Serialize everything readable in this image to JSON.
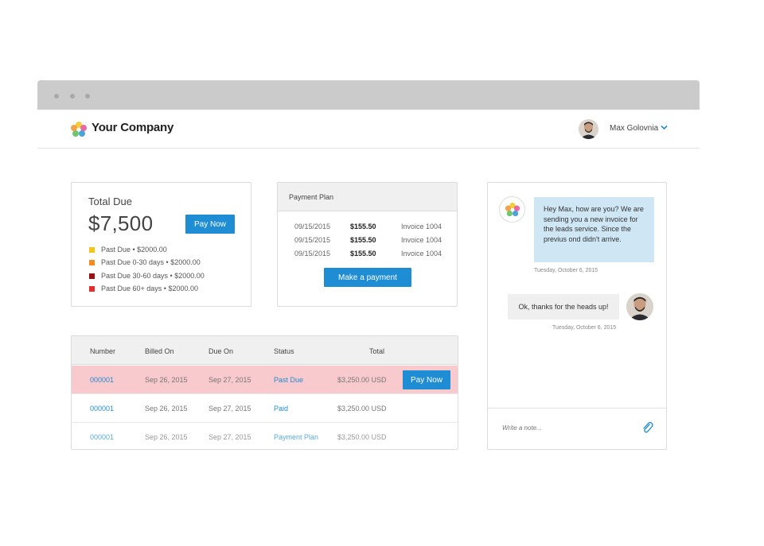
{
  "header": {
    "company_name": "Your Company",
    "user_name": "Max Golovnia"
  },
  "total_due": {
    "title": "Total Due",
    "amount": "$7,500",
    "pay_button": "Pay Now",
    "legend": [
      {
        "label": "Past Due • $2000.00",
        "color": "#f5c518"
      },
      {
        "label": "Past Due 0-30 days • $2000.00",
        "color": "#f28c1e"
      },
      {
        "label": "Past Due 30-60 days • $2000.00",
        "color": "#9b1010"
      },
      {
        "label": "Past Due 60+ days • $2000.00",
        "color": "#e52d2d"
      }
    ]
  },
  "payment_plan": {
    "title": "Payment Plan",
    "rows": [
      {
        "date": "09/15/2015",
        "amount": "$155.50",
        "invoice": "Invoice 1004"
      },
      {
        "date": "09/15/2015",
        "amount": "$155.50",
        "invoice": "Invoice 1004"
      },
      {
        "date": "09/15/2015",
        "amount": "$155.50",
        "invoice": "Invoice 1004"
      }
    ],
    "button": "Make a payment"
  },
  "invoices": {
    "columns": {
      "number": "Number",
      "billed_on": "Billed On",
      "due_on": "Due On",
      "status": "Status",
      "total": "Total"
    },
    "rows": [
      {
        "number": "000001",
        "billed_on": "Sep 26, 2015",
        "due_on": "Sep 27, 2015",
        "status": "Past Due",
        "total": "$3,250.00 USD",
        "action": "Pay Now"
      },
      {
        "number": "000001",
        "billed_on": "Sep 26, 2015",
        "due_on": "Sep 27, 2015",
        "status": "Paid",
        "total": "$3,250.00 USD"
      },
      {
        "number": "000001",
        "billed_on": "Sep 26, 2015",
        "due_on": "Sep 27, 2015",
        "status": "Payment Plan",
        "total": "$3,250.00 USD"
      }
    ]
  },
  "chat": {
    "incoming_message": "Hey Max, how are you? We are sending you a new invoice for the leads service. Since the previus ond didn't arrive.",
    "incoming_time": "Tuesday, October 6, 2015",
    "outgoing_message": "Ok, thanks for the heads up!",
    "outgoing_time": "Tuesday, October 6, 2015",
    "compose_placeholder": "Write a note..."
  },
  "colors": {
    "accent": "#1f8dd3",
    "past_due_row": "#f8c9cd",
    "incoming_bubble": "#cfe6f5"
  },
  "icons": [
    "company-logo-icon",
    "chevron-down-icon",
    "paperclip-icon",
    "avatar"
  ]
}
